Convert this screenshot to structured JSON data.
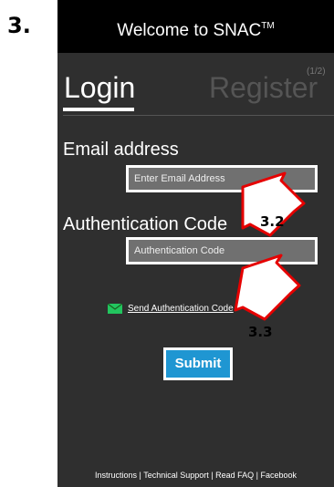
{
  "step_label": "3.",
  "app": {
    "title": "Welcome to SNAC",
    "title_mark": "TM",
    "tabs": {
      "login": "Login",
      "register": "Register",
      "page_indicator": "(1/2)"
    }
  },
  "form": {
    "email_label": "Email address",
    "email_placeholder": "Enter Email Address",
    "auth_label": "Authentication Code",
    "auth_placeholder": "Authentication Code",
    "send_code_link": "Send Authentication Code",
    "submit_label": "Submit"
  },
  "footer": {
    "links": [
      "Instructions",
      "Technical Support",
      "Read FAQ",
      "Facebook"
    ],
    "text": "Instructions | Technical Support | Read FAQ | Facebook"
  },
  "callouts": [
    {
      "label": "3.2",
      "target": "authentication-code-field"
    },
    {
      "label": "3.3",
      "target": "submit-button"
    }
  ],
  "colors": {
    "phone_background": "#2f2f2f",
    "title_bar": "#000000",
    "input_fill": "#707070",
    "submit_button": "#1f96d2",
    "mail_icon": "#22c55e",
    "callout_arrow_stroke": "#e50000"
  },
  "icons": {
    "send_code": "mail-icon",
    "callout": "arrow-callout"
  }
}
